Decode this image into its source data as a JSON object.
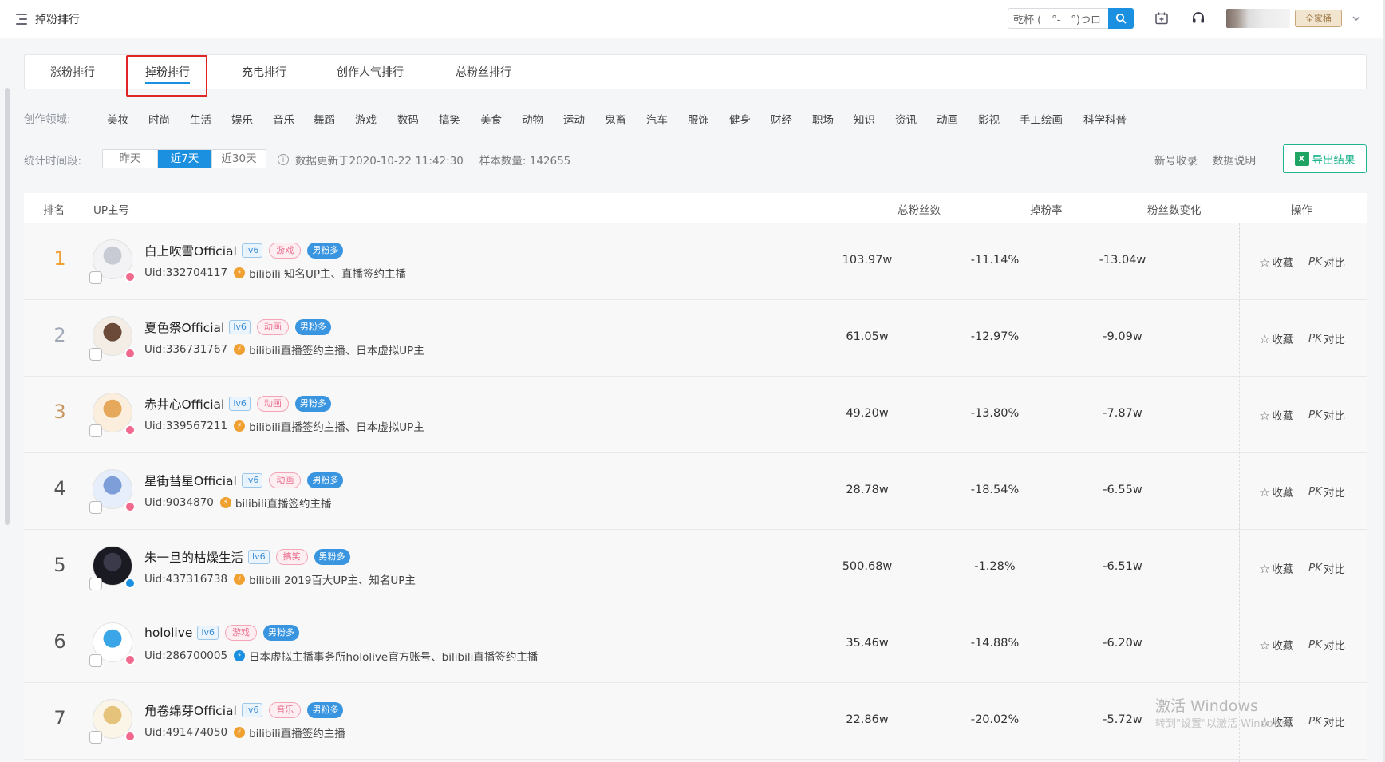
{
  "header": {
    "title": "掉粉排行",
    "search_value": "乾杯 (　°-　°)つロ",
    "family_badge": "全家桶"
  },
  "tabs": [
    {
      "label": "涨粉排行"
    },
    {
      "label": "掉粉排行"
    },
    {
      "label": "充电排行"
    },
    {
      "label": "创作人气排行"
    },
    {
      "label": "总粉丝排行"
    }
  ],
  "categories": {
    "label": "创作领域:",
    "items": [
      "美妆",
      "时尚",
      "生活",
      "娱乐",
      "音乐",
      "舞蹈",
      "游戏",
      "数码",
      "搞笑",
      "美食",
      "动物",
      "运动",
      "鬼畜",
      "汽车",
      "服饰",
      "健身",
      "财经",
      "职场",
      "知识",
      "资讯",
      "动画",
      "影视",
      "手工绘画",
      "科学科普"
    ]
  },
  "period": {
    "label": "统计时间段:",
    "options": [
      "昨天",
      "近7天",
      "近30天"
    ],
    "selected": "近7天",
    "update_text": "数据更新于2020-10-22 11:42:30",
    "sample_text": "样本数量: 142655"
  },
  "links": {
    "new_account": "新号收录",
    "data_desc": "数据说明",
    "export": "导出结果"
  },
  "table": {
    "headers": {
      "rank": "排名",
      "up": "UP主号",
      "fans": "总粉丝数",
      "rate": "掉粉率",
      "change": "粉丝数变化",
      "ops": "操作"
    },
    "fav_label": "收藏",
    "pk_label": "对比",
    "rows": [
      {
        "rank": "1",
        "name": "白上吹雪Official",
        "lv": "lv6",
        "category": "游戏",
        "gender": "男粉多",
        "uid": "Uid:332704117",
        "desc": "bilibili 知名UP主、直播签约主播",
        "fans": "103.97w",
        "rate": "-11.14%",
        "change": "-13.04w",
        "verify": "gold"
      },
      {
        "rank": "2",
        "name": "夏色祭Official",
        "lv": "lv6",
        "category": "动画",
        "gender": "男粉多",
        "uid": "Uid:336731767",
        "desc": "bilibili直播签约主播、日本虚拟UP主",
        "fans": "61.05w",
        "rate": "-12.97%",
        "change": "-9.09w",
        "verify": "gold"
      },
      {
        "rank": "3",
        "name": "赤井心Official",
        "lv": "lv6",
        "category": "动画",
        "gender": "男粉多",
        "uid": "Uid:339567211",
        "desc": "bilibili直播签约主播、日本虚拟UP主",
        "fans": "49.20w",
        "rate": "-13.80%",
        "change": "-7.87w",
        "verify": "gold"
      },
      {
        "rank": "4",
        "name": "星街彗星Official",
        "lv": "lv6",
        "category": "动画",
        "gender": "男粉多",
        "uid": "Uid:9034870",
        "desc": "bilibili直播签约主播",
        "fans": "28.78w",
        "rate": "-18.54%",
        "change": "-6.55w",
        "verify": "gold"
      },
      {
        "rank": "5",
        "name": "朱一旦的枯燥生活",
        "lv": "lv6",
        "category": "搞笑",
        "gender": "男粉多",
        "uid": "Uid:437316738",
        "desc": "bilibili 2019百大UP主、知名UP主",
        "fans": "500.68w",
        "rate": "-1.28%",
        "change": "-6.51w",
        "verify": "gold"
      },
      {
        "rank": "6",
        "name": "hololive",
        "lv": "lv6",
        "category": "游戏",
        "gender": "男粉多",
        "uid": "Uid:286700005",
        "desc": "日本虚拟主播事务所hololive官方账号、bilibili直播签约主播",
        "fans": "35.46w",
        "rate": "-14.88%",
        "change": "-6.20w",
        "verify": "blue"
      },
      {
        "rank": "7",
        "name": "角卷绵芽Official",
        "lv": "lv6",
        "category": "音乐",
        "gender": "男粉多",
        "uid": "Uid:491474050",
        "desc": "bilibili直播签约主播",
        "fans": "22.86w",
        "rate": "-20.02%",
        "change": "-5.72w",
        "verify": "gold"
      }
    ]
  },
  "watermark": {
    "line1": "激活 Windows",
    "line2": "转到\"设置\"以激活 Windows。"
  },
  "colors": {
    "accent": "#1b8fe0",
    "export_green": "#1fb48f",
    "highlight_red": "#e02525",
    "rank_gold": "#f0a030",
    "rank_silver": "#a0a8b8",
    "rank_bronze": "#c99860"
  }
}
